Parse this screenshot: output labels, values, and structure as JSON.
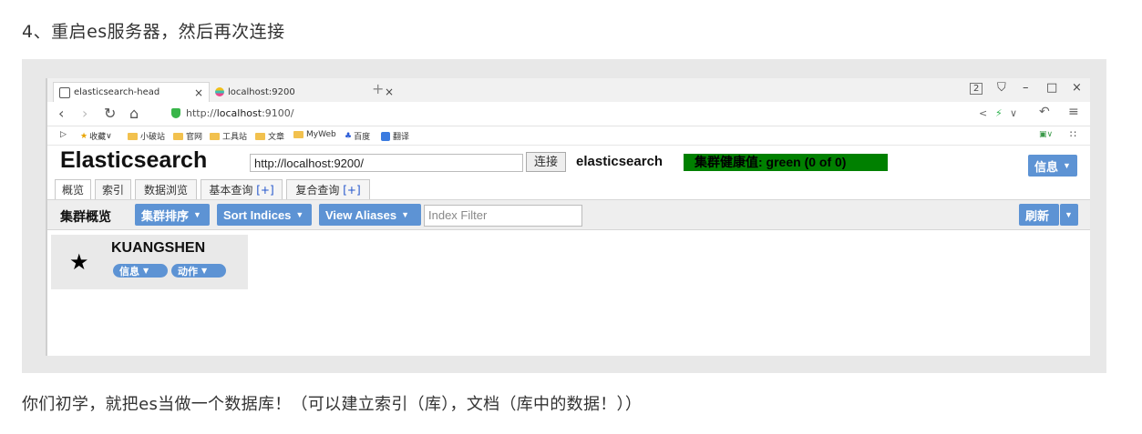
{
  "doc": {
    "heading": "4、重启es服务器，然后再次连接",
    "caption": "你们初学，就把es当做一个数据库！（可以建立索引（库），文档（库中的数据！））"
  },
  "browser": {
    "tabs": [
      {
        "label": "elasticsearch-head",
        "close": "×"
      },
      {
        "label": "localhost:9200",
        "close": "×"
      }
    ],
    "new_tab": "+",
    "window_controls": {
      "badge": "2",
      "shirt": "⛉",
      "minimize": "–",
      "maximize": "□",
      "close": "×"
    },
    "url_prefix": "http://",
    "url_host": "localhost",
    "url_rest": ":9100/",
    "bookmarks": [
      {
        "label": "收藏",
        "icon": "star"
      },
      {
        "label": "小破站",
        "icon": "folder"
      },
      {
        "label": "官网",
        "icon": "folder"
      },
      {
        "label": "工具站",
        "icon": "folder"
      },
      {
        "label": "文章",
        "icon": "folder"
      },
      {
        "label": "MyWeb",
        "icon": "folder"
      },
      {
        "label": "百度",
        "icon": "baidu"
      },
      {
        "label": "翻译",
        "icon": "translate"
      }
    ]
  },
  "es_head": {
    "title": "Elasticsearch",
    "connect_url": "http://localhost:9200/",
    "connect_button": "连接",
    "cluster_name": "elasticsearch",
    "health": "集群健康值: green (0 of 0)",
    "info_button": "信息",
    "tabs": [
      {
        "label": "概览",
        "plus": ""
      },
      {
        "label": "索引",
        "plus": ""
      },
      {
        "label": "数据浏览",
        "plus": ""
      },
      {
        "label": "基本查询 ",
        "plus": "[+]"
      },
      {
        "label": "复合查询 ",
        "plus": "[+]"
      }
    ],
    "toolbar": {
      "title": "集群概览",
      "sort_cluster": "集群排序",
      "sort_indices": "Sort Indices",
      "view_aliases": "View Aliases",
      "filter_placeholder": "Index Filter",
      "refresh": "刷新"
    },
    "node": {
      "name": "KUANGSHEN",
      "info": "信息",
      "actions": "动作"
    }
  },
  "colors": {
    "health_green": "#008000",
    "button_blue": "#5d93d4"
  }
}
